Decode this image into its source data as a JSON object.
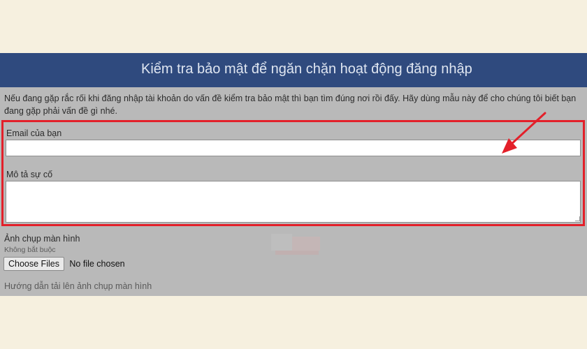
{
  "header": {
    "title": "Kiểm tra bảo mật để ngăn chặn hoạt động đăng nhập"
  },
  "intro": {
    "text": "Nếu đang gặp rắc rối khi đăng nhập tài khoản do vấn đề kiểm tra bảo mật thì bạn tìm đúng nơi rồi đấy. Hãy dùng mẫu này để cho chúng tôi biết bạn đang gặp phải vấn đề gì nhé."
  },
  "form": {
    "email_label": "Email của bạn",
    "email_value": "",
    "description_label": "Mô tả sự cố",
    "description_value": ""
  },
  "screenshot": {
    "label": "Ảnh chụp màn hình",
    "optional": "Không bắt buộc",
    "choose_button": "Choose Files",
    "status": "No file chosen",
    "help_link": "Hướng dẫn tải lên ảnh chụp màn hình"
  },
  "colors": {
    "header_bg": "#2f4a7e",
    "highlight_border": "#e3202a",
    "arrow": "#e3202a"
  },
  "icons": {
    "annotation": "red-arrow-icon",
    "watermark": "watermark-logo-icon"
  }
}
